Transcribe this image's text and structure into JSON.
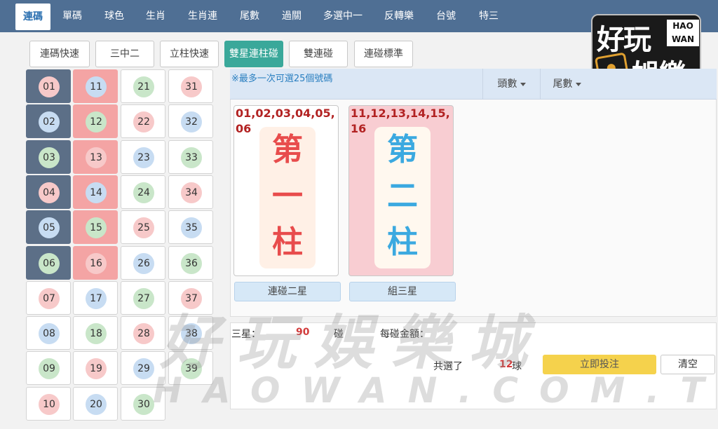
{
  "nav": {
    "tabs": [
      "連碼",
      "單碼",
      "球色",
      "生肖",
      "生肖連",
      "尾數",
      "過關",
      "多選中一",
      "反轉樂",
      "台號",
      "特三"
    ],
    "active": "連碼"
  },
  "logo": {
    "line1": "好玩",
    "line2": "娛樂",
    "badge_top": "HAO",
    "badge_bottom": "WAN"
  },
  "subtabs": [
    "連碼快速",
    "三中二",
    "立柱快速",
    "雙星連柱碰",
    "雙連碰",
    "連碰標準"
  ],
  "active_subtab": "雙星連柱碰",
  "numbers": [
    {
      "n": "01",
      "color": "red",
      "sel": 1
    },
    {
      "n": "11",
      "color": "blue",
      "sel": 2
    },
    {
      "n": "21",
      "color": "green",
      "sel": 0
    },
    {
      "n": "31",
      "color": "red",
      "sel": 0
    },
    {
      "n": "02",
      "color": "blue",
      "sel": 1
    },
    {
      "n": "12",
      "color": "green",
      "sel": 2
    },
    {
      "n": "22",
      "color": "red",
      "sel": 0
    },
    {
      "n": "32",
      "color": "blue",
      "sel": 0
    },
    {
      "n": "03",
      "color": "green",
      "sel": 1
    },
    {
      "n": "13",
      "color": "red",
      "sel": 2
    },
    {
      "n": "23",
      "color": "blue",
      "sel": 0
    },
    {
      "n": "33",
      "color": "green",
      "sel": 0
    },
    {
      "n": "04",
      "color": "red",
      "sel": 1
    },
    {
      "n": "14",
      "color": "blue",
      "sel": 2
    },
    {
      "n": "24",
      "color": "green",
      "sel": 0
    },
    {
      "n": "34",
      "color": "red",
      "sel": 0
    },
    {
      "n": "05",
      "color": "blue",
      "sel": 1
    },
    {
      "n": "15",
      "color": "green",
      "sel": 2
    },
    {
      "n": "25",
      "color": "red",
      "sel": 0
    },
    {
      "n": "35",
      "color": "blue",
      "sel": 0
    },
    {
      "n": "06",
      "color": "green",
      "sel": 1
    },
    {
      "n": "16",
      "color": "red",
      "sel": 2
    },
    {
      "n": "26",
      "color": "blue",
      "sel": 0
    },
    {
      "n": "36",
      "color": "green",
      "sel": 0
    },
    {
      "n": "07",
      "color": "red",
      "sel": 0
    },
    {
      "n": "17",
      "color": "blue",
      "sel": 0
    },
    {
      "n": "27",
      "color": "green",
      "sel": 0
    },
    {
      "n": "37",
      "color": "red",
      "sel": 0
    },
    {
      "n": "08",
      "color": "blue",
      "sel": 0
    },
    {
      "n": "18",
      "color": "green",
      "sel": 0
    },
    {
      "n": "28",
      "color": "red",
      "sel": 0
    },
    {
      "n": "38",
      "color": "blue",
      "sel": 0
    },
    {
      "n": "09",
      "color": "green",
      "sel": 0
    },
    {
      "n": "19",
      "color": "red",
      "sel": 0
    },
    {
      "n": "29",
      "color": "blue",
      "sel": 0
    },
    {
      "n": "39",
      "color": "green",
      "sel": 0
    },
    {
      "n": "10",
      "color": "red",
      "sel": 0
    },
    {
      "n": "20",
      "color": "blue",
      "sel": 0
    },
    {
      "n": "30",
      "color": "green",
      "sel": 0
    }
  ],
  "notice": "※最多一次可選25個號碼",
  "filters": {
    "head": "頭數",
    "tail": "尾數"
  },
  "columns": [
    {
      "nums": "01,02,03,04,05,06",
      "label_chars": [
        "第",
        "一",
        "柱"
      ]
    },
    {
      "nums": "11,12,13,14,15,16",
      "label_chars": [
        "第",
        "二",
        "柱"
      ]
    }
  ],
  "options": [
    "連碰二星",
    "組三星"
  ],
  "summary": {
    "type_label": "三星：",
    "combos": "90",
    "combos_unit": "碰",
    "amount_label": "每碰金額：",
    "selected_prefix": "共選了",
    "selected_count": "12",
    "selected_unit": "球",
    "submit": "立即投注",
    "clear": "清空"
  },
  "watermark": {
    "line1": "好玩娛樂城",
    "line2": "HAOWAN.COM.TW"
  },
  "colors": {
    "nav_bg": "#4f6f94",
    "accent_teal": "#3aa89a",
    "col1_selected": "#5c6f87",
    "col2_selected": "#f4a4a4",
    "submit_yellow": "#f5d24c"
  }
}
